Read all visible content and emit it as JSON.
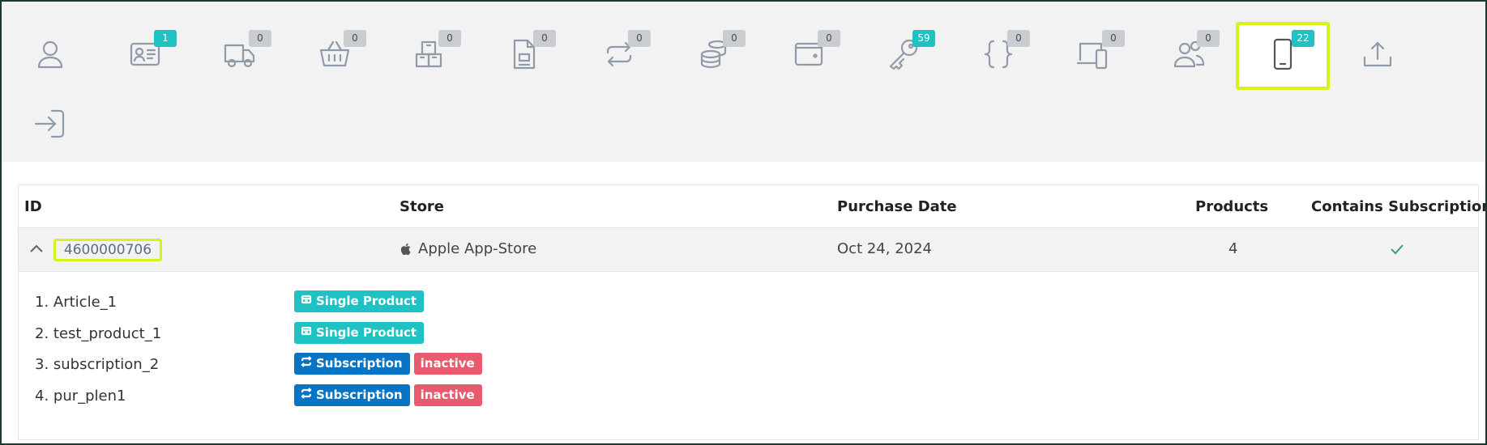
{
  "toolbar": {
    "tools": [
      {
        "icon": "user-icon",
        "badge": ""
      },
      {
        "icon": "id-card-icon",
        "badge": "1",
        "badge_style": "teal"
      },
      {
        "icon": "truck-icon",
        "badge": "0"
      },
      {
        "icon": "basket-icon",
        "badge": "0"
      },
      {
        "icon": "boxes-icon",
        "badge": "0"
      },
      {
        "icon": "document-icon",
        "badge": "0"
      },
      {
        "icon": "repeat-icon",
        "badge": "0"
      },
      {
        "icon": "coins-icon",
        "badge": "0"
      },
      {
        "icon": "wallet-icon",
        "badge": "0"
      },
      {
        "icon": "key-icon",
        "badge": "59",
        "badge_style": "teal"
      },
      {
        "icon": "braces-icon",
        "badge": "0"
      },
      {
        "icon": "devices-icon",
        "badge": "0"
      },
      {
        "icon": "users-icon",
        "badge": "0"
      },
      {
        "icon": "mobile-icon",
        "badge": "22",
        "badge_style": "teal",
        "active": true
      },
      {
        "icon": "upload-icon",
        "badge": ""
      },
      {
        "icon": "sign-in-icon",
        "badge": ""
      }
    ]
  },
  "table": {
    "headers": {
      "id": "ID",
      "store": "Store",
      "purchase_date": "Purchase Date",
      "products": "Products",
      "contains_subscription": "Contains Subscription"
    },
    "row": {
      "id": "4600000706",
      "store": "Apple App-Store",
      "store_icon": "apple-icon",
      "purchase_date": "Oct 24, 2024",
      "products": "4",
      "contains_subscription_icon": "check-icon"
    },
    "items": [
      {
        "name": "1. Article_1",
        "tags": [
          {
            "label": "Single Product",
            "style": "single",
            "icon": "box-icon"
          }
        ]
      },
      {
        "name": "2. test_product_1",
        "tags": [
          {
            "label": "Single Product",
            "style": "single",
            "icon": "box-icon"
          }
        ]
      },
      {
        "name": "3. subscription_2",
        "tags": [
          {
            "label": "Subscription",
            "style": "sub",
            "icon": "repeat-icon"
          },
          {
            "label": "inactive",
            "style": "inactive"
          }
        ]
      },
      {
        "name": "4. pur_plen1",
        "tags": [
          {
            "label": "Subscription",
            "style": "sub",
            "icon": "repeat-icon"
          },
          {
            "label": "inactive",
            "style": "inactive"
          }
        ]
      }
    ]
  },
  "colors": {
    "highlight": "#d9f21a",
    "teal": "#1ec2c2",
    "subscription": "#0a74c4",
    "inactive": "#e85a6e",
    "check": "#38a169"
  }
}
